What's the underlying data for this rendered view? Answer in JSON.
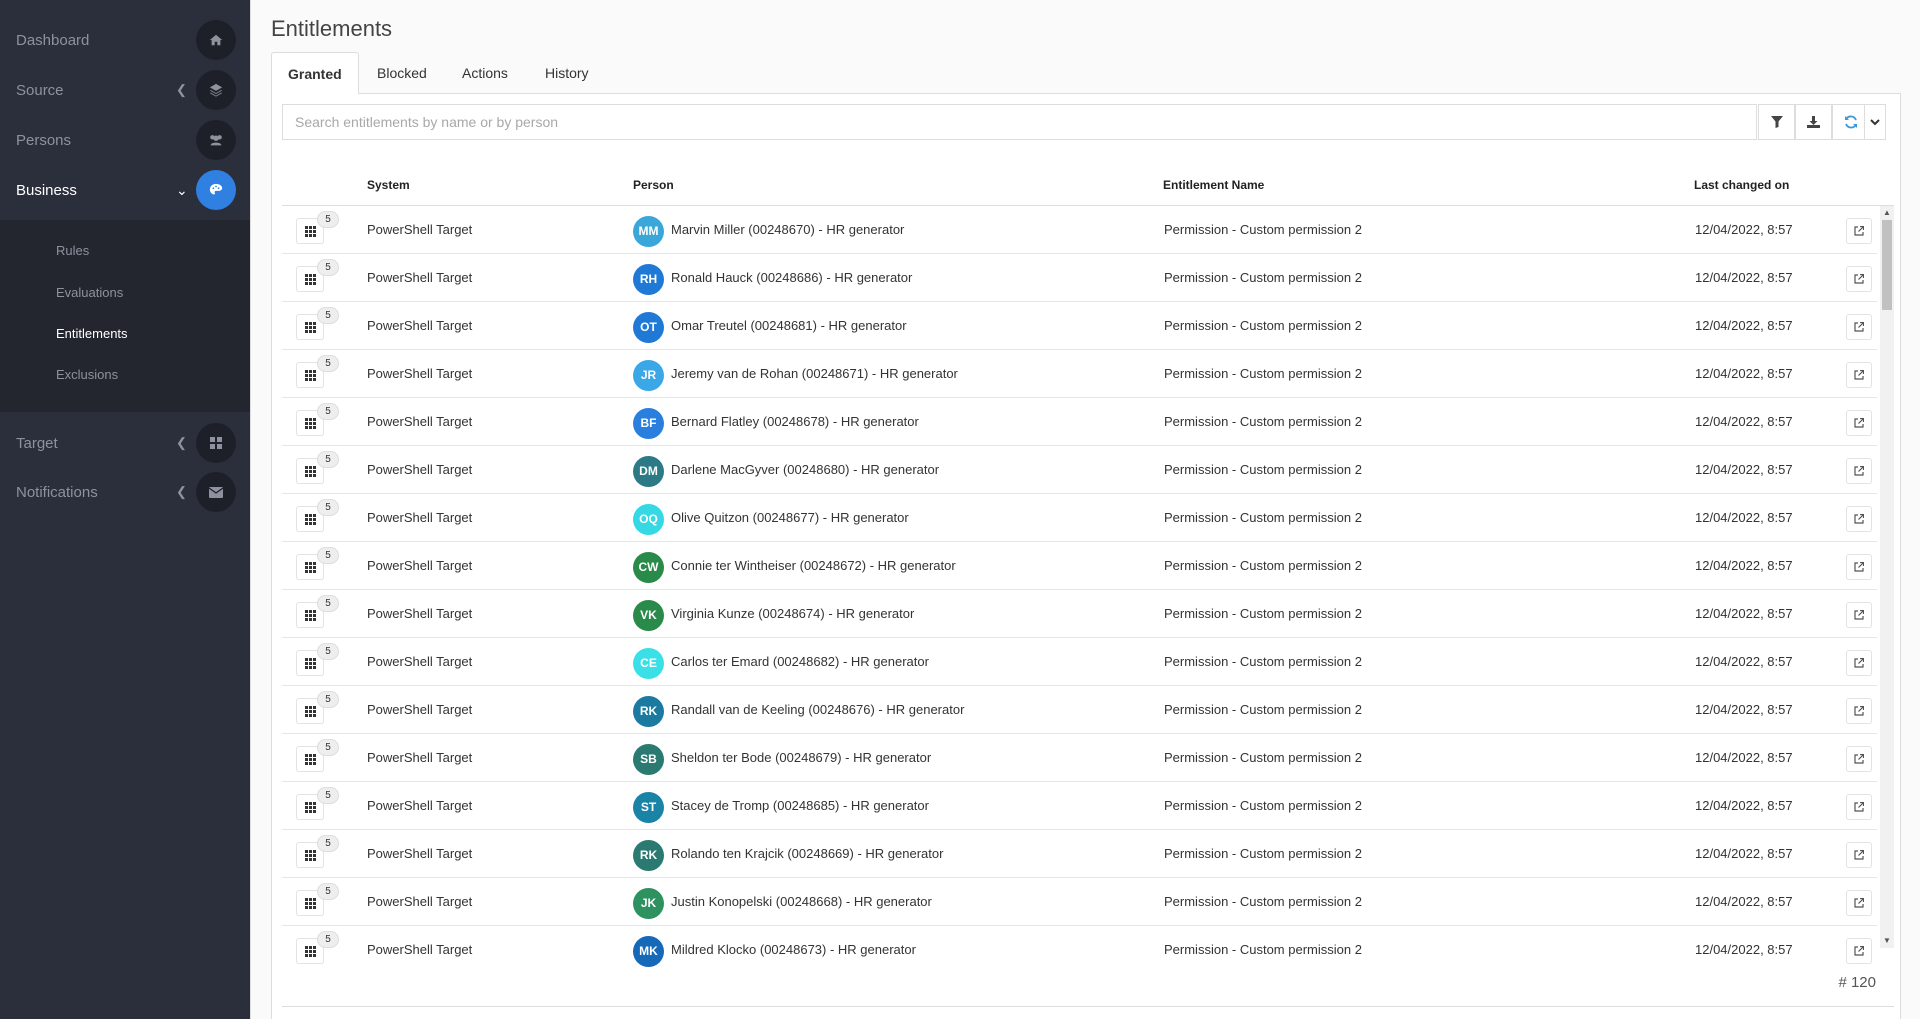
{
  "sidebar": {
    "items": [
      {
        "label": "Dashboard",
        "icon": "home-icon"
      },
      {
        "label": "Source",
        "icon": "layers-icon"
      },
      {
        "label": "Persons",
        "icon": "users-icon"
      },
      {
        "label": "Business",
        "icon": "palette-icon"
      },
      {
        "label": "Target",
        "icon": "grid-icon"
      },
      {
        "label": "Notifications",
        "icon": "envelope-icon"
      }
    ],
    "subitems": [
      {
        "label": "Rules"
      },
      {
        "label": "Evaluations"
      },
      {
        "label": "Entitlements"
      },
      {
        "label": "Exclusions"
      }
    ]
  },
  "page": {
    "title": "Entitlements"
  },
  "tabs": [
    {
      "label": "Granted"
    },
    {
      "label": "Blocked"
    },
    {
      "label": "Actions"
    },
    {
      "label": "History"
    }
  ],
  "search": {
    "placeholder": "Search entitlements by name or by person"
  },
  "table": {
    "headers": {
      "system": "System",
      "person": "Person",
      "entitlement": "Entitlement Name",
      "last_changed": "Last changed on"
    },
    "rows": [
      {
        "badge": "5",
        "system": "PowerShell Target",
        "initials": "MM",
        "color": "#3ba7d9",
        "person": "Marvin Miller (00248670) - HR generator",
        "entitlement": "Permission - Custom permission 2",
        "date": "12/04/2022, 8:57"
      },
      {
        "badge": "5",
        "system": "PowerShell Target",
        "initials": "RH",
        "color": "#1f7ad6",
        "person": "Ronald Hauck (00248686) - HR generator",
        "entitlement": "Permission - Custom permission 2",
        "date": "12/04/2022, 8:57"
      },
      {
        "badge": "5",
        "system": "PowerShell Target",
        "initials": "OT",
        "color": "#1f7ad6",
        "person": "Omar Treutel (00248681) - HR generator",
        "entitlement": "Permission - Custom permission 2",
        "date": "12/04/2022, 8:57"
      },
      {
        "badge": "5",
        "system": "PowerShell Target",
        "initials": "JR",
        "color": "#3ba7e6",
        "person": "Jeremy van de Rohan (00248671) - HR generator",
        "entitlement": "Permission - Custom permission 2",
        "date": "12/04/2022, 8:57"
      },
      {
        "badge": "5",
        "system": "PowerShell Target",
        "initials": "BF",
        "color": "#2a7fde",
        "person": "Bernard Flatley (00248678) - HR generator",
        "entitlement": "Permission - Custom permission 2",
        "date": "12/04/2022, 8:57"
      },
      {
        "badge": "5",
        "system": "PowerShell Target",
        "initials": "DM",
        "color": "#2b7a85",
        "person": "Darlene MacGyver (00248680) - HR generator",
        "entitlement": "Permission - Custom permission 2",
        "date": "12/04/2022, 8:57"
      },
      {
        "badge": "5",
        "system": "PowerShell Target",
        "initials": "OQ",
        "color": "#36d8e4",
        "person": "Olive Quitzon (00248677) - HR generator",
        "entitlement": "Permission - Custom permission 2",
        "date": "12/04/2022, 8:57"
      },
      {
        "badge": "5",
        "system": "PowerShell Target",
        "initials": "CW",
        "color": "#2a8a4a",
        "person": "Connie ter Wintheiser (00248672) - HR generator",
        "entitlement": "Permission - Custom permission 2",
        "date": "12/04/2022, 8:57"
      },
      {
        "badge": "5",
        "system": "PowerShell Target",
        "initials": "VK",
        "color": "#2a8a4a",
        "person": "Virginia Kunze (00248674) - HR generator",
        "entitlement": "Permission - Custom permission 2",
        "date": "12/04/2022, 8:57"
      },
      {
        "badge": "5",
        "system": "PowerShell Target",
        "initials": "CE",
        "color": "#3ae0e6",
        "person": "Carlos ter Emard (00248682) - HR generator",
        "entitlement": "Permission - Custom permission 2",
        "date": "12/04/2022, 8:57"
      },
      {
        "badge": "5",
        "system": "PowerShell Target",
        "initials": "RK",
        "color": "#1a7aa0",
        "person": "Randall van de Keeling (00248676) - HR generator",
        "entitlement": "Permission - Custom permission 2",
        "date": "12/04/2022, 8:57"
      },
      {
        "badge": "5",
        "system": "PowerShell Target",
        "initials": "SB",
        "color": "#2b7a72",
        "person": "Sheldon ter Bode (00248679) - HR generator",
        "entitlement": "Permission - Custom permission 2",
        "date": "12/04/2022, 8:57"
      },
      {
        "badge": "5",
        "system": "PowerShell Target",
        "initials": "ST",
        "color": "#1a84a6",
        "person": "Stacey de Tromp (00248685) - HR generator",
        "entitlement": "Permission - Custom permission 2",
        "date": "12/04/2022, 8:57"
      },
      {
        "badge": "5",
        "system": "PowerShell Target",
        "initials": "RK",
        "color": "#2b7a72",
        "person": "Rolando ten Krajcik (00248669) - HR generator",
        "entitlement": "Permission - Custom permission 2",
        "date": "12/04/2022, 8:57"
      },
      {
        "badge": "5",
        "system": "PowerShell Target",
        "initials": "JK",
        "color": "#2e9160",
        "person": "Justin Konopelski (00248668) - HR generator",
        "entitlement": "Permission - Custom permission 2",
        "date": "12/04/2022, 8:57"
      },
      {
        "badge": "5",
        "system": "PowerShell Target",
        "initials": "MK",
        "color": "#1668b8",
        "person": "Mildred Klocko (00248673) - HR generator",
        "entitlement": "Permission - Custom permission 2",
        "date": "12/04/2022, 8:57"
      }
    ]
  },
  "footer": {
    "count": "# 120"
  },
  "colors": {
    "accent": "#2f80e0",
    "sidebar_bg": "#2b2e3b",
    "refresh_icon": "#3a9ad9"
  }
}
